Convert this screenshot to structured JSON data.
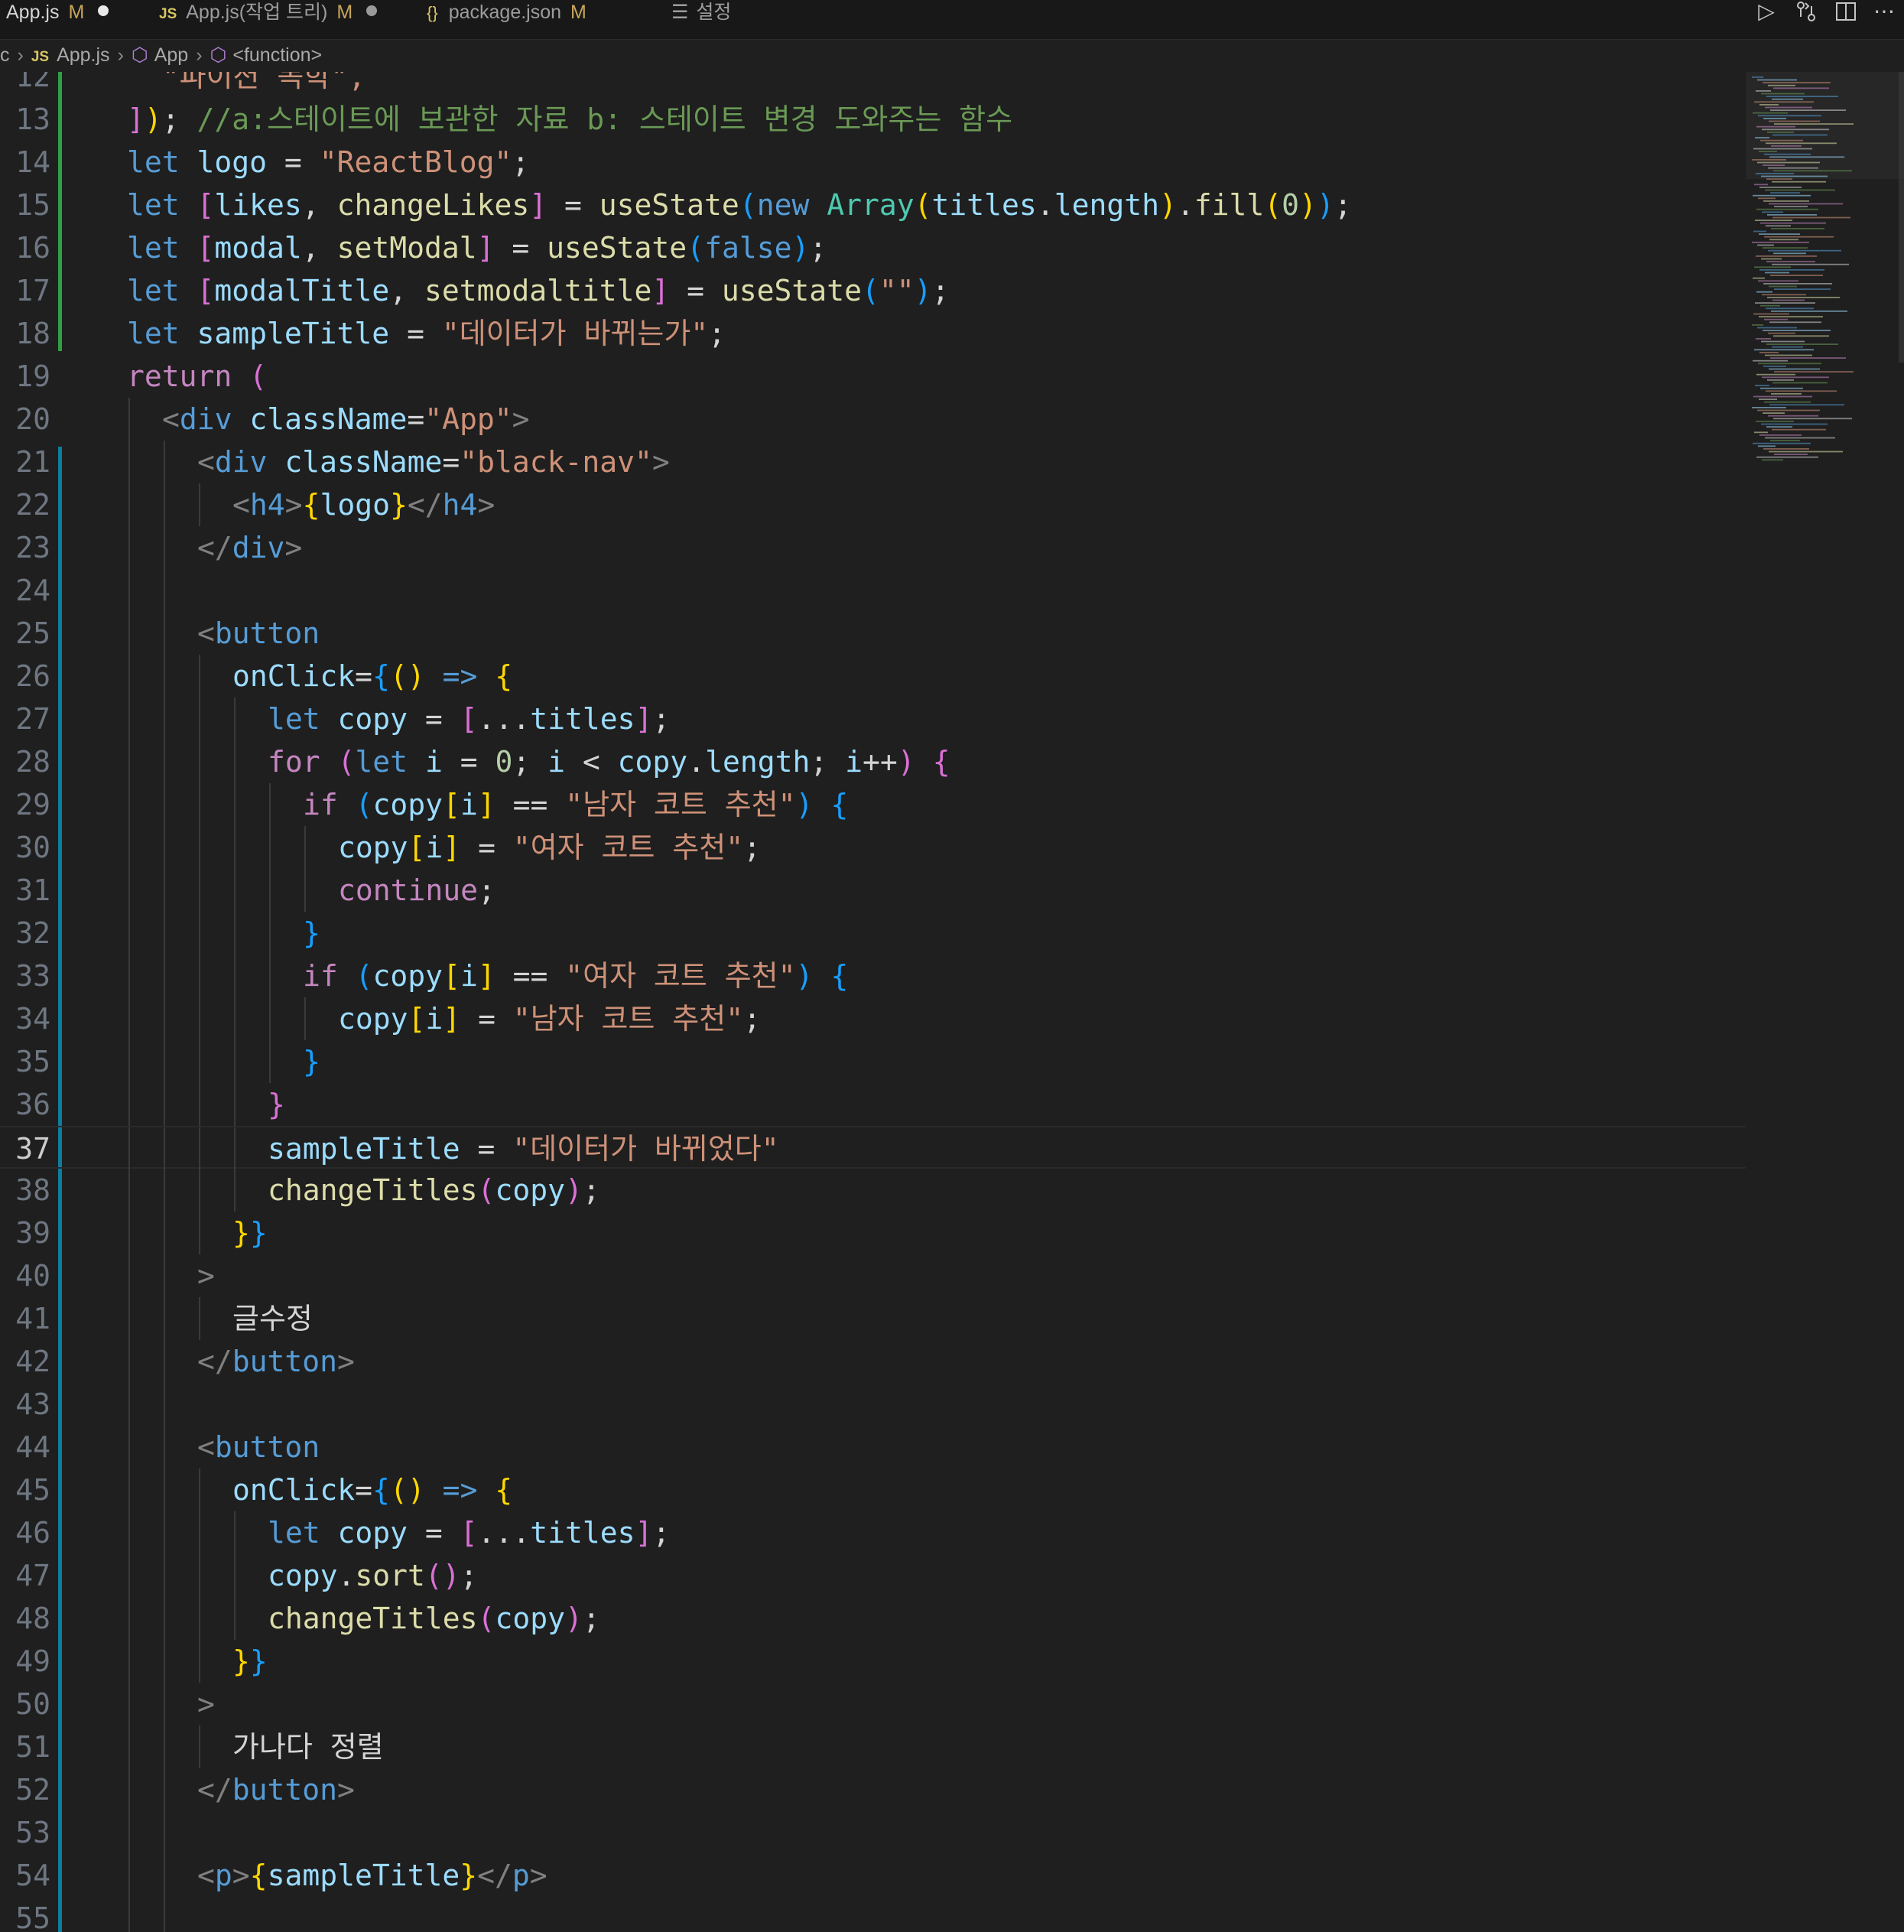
{
  "tabs": [
    {
      "label": "App.js",
      "modified": "M",
      "has_dot": true
    },
    {
      "label": "App.js(작업 트리)",
      "modified": "M",
      "has_dot": true
    },
    {
      "label": "package.json",
      "modified": "M",
      "has_dot": false
    },
    {
      "label": "설정",
      "modified": "",
      "has_dot": false
    }
  ],
  "tab_icons": {
    "js": "JS",
    "json": "{}",
    "settings": "settings-lines-icon"
  },
  "toolbar": [
    "run-icon",
    "git-compare-icon",
    "split-editor-icon",
    "more-actions-icon"
  ],
  "breadcrumbs": [
    "c",
    "App.js",
    "App",
    "<function>"
  ],
  "current_line": 37,
  "colors": {
    "keyword": "#569cd6",
    "control": "#c586c0",
    "string": "#ce9178",
    "variable": "#9cdcfe",
    "function": "#dcdcaa",
    "type": "#4ec9b0",
    "comment": "#6a9955",
    "number": "#b5cea8",
    "tag": "#569cd6",
    "tag_bracket": "#808080",
    "bracket1": "#ffd700",
    "bracket2": "#da70d6",
    "bracket3": "#179fff",
    "text": "#d4d4d4",
    "jsx_text": "#d4d4d4"
  },
  "lines": [
    {
      "n": 12,
      "indent": 1,
      "tokens": [
        [
          "s",
          "  \"파이션 독학\","
        ]
      ]
    },
    {
      "n": 13,
      "indent": 1,
      "tokens": [
        [
          "b2",
          "]"
        ],
        [
          "b1",
          ")"
        ],
        [
          "p",
          ";"
        ],
        [
          "c",
          " //a:스테이트에 보관한 자료 b: 스테이트 변경 도와주는 함수"
        ]
      ]
    },
    {
      "n": 14,
      "indent": 1,
      "tokens": [
        [
          "k",
          "let"
        ],
        [
          "p",
          " "
        ],
        [
          "v",
          "logo"
        ],
        [
          "p",
          " = "
        ],
        [
          "s",
          "\"ReactBlog\""
        ],
        [
          "p",
          ";"
        ]
      ]
    },
    {
      "n": 15,
      "indent": 1,
      "tokens": [
        [
          "k",
          "let"
        ],
        [
          "p",
          " "
        ],
        [
          "b2",
          "["
        ],
        [
          "v",
          "likes"
        ],
        [
          "p",
          ", "
        ],
        [
          "f",
          "changeLikes"
        ],
        [
          "b2",
          "]"
        ],
        [
          "p",
          " = "
        ],
        [
          "f",
          "useState"
        ],
        [
          "b3",
          "("
        ],
        [
          "k",
          "new"
        ],
        [
          "p",
          " "
        ],
        [
          "t",
          "Array"
        ],
        [
          "b1",
          "("
        ],
        [
          "v",
          "titles"
        ],
        [
          "p",
          "."
        ],
        [
          "v",
          "length"
        ],
        [
          "b1",
          ")"
        ],
        [
          "p",
          "."
        ],
        [
          "f",
          "fill"
        ],
        [
          "b1",
          "("
        ],
        [
          "n",
          "0"
        ],
        [
          "b1",
          ")"
        ],
        [
          "b3",
          ")"
        ],
        [
          "p",
          ";"
        ]
      ]
    },
    {
      "n": 16,
      "indent": 1,
      "tokens": [
        [
          "k",
          "let"
        ],
        [
          "p",
          " "
        ],
        [
          "b2",
          "["
        ],
        [
          "v",
          "modal"
        ],
        [
          "p",
          ", "
        ],
        [
          "f",
          "setModal"
        ],
        [
          "b2",
          "]"
        ],
        [
          "p",
          " = "
        ],
        [
          "f",
          "useState"
        ],
        [
          "b3",
          "("
        ],
        [
          "k",
          "false"
        ],
        [
          "b3",
          ")"
        ],
        [
          "p",
          ";"
        ]
      ]
    },
    {
      "n": 17,
      "indent": 1,
      "tokens": [
        [
          "k",
          "let"
        ],
        [
          "p",
          " "
        ],
        [
          "b2",
          "["
        ],
        [
          "v",
          "modalTitle"
        ],
        [
          "p",
          ", "
        ],
        [
          "f",
          "setmodaltitle"
        ],
        [
          "b2",
          "]"
        ],
        [
          "p",
          " = "
        ],
        [
          "f",
          "useState"
        ],
        [
          "b3",
          "("
        ],
        [
          "s",
          "\"\""
        ],
        [
          "b3",
          ")"
        ],
        [
          "p",
          ";"
        ]
      ]
    },
    {
      "n": 18,
      "indent": 1,
      "tokens": [
        [
          "k",
          "let"
        ],
        [
          "p",
          " "
        ],
        [
          "v",
          "sampleTitle"
        ],
        [
          "p",
          " = "
        ],
        [
          "s",
          "\"데이터가 바뀌는가\""
        ],
        [
          "p",
          ";"
        ]
      ]
    },
    {
      "n": 19,
      "indent": 1,
      "tokens": [
        [
          "x",
          "return"
        ],
        [
          "p",
          " "
        ],
        [
          "b2",
          "("
        ]
      ]
    },
    {
      "n": 20,
      "indent": 2,
      "tokens": [
        [
          "g",
          "<"
        ],
        [
          "tg",
          "div"
        ],
        [
          "p",
          " "
        ],
        [
          "v",
          "className"
        ],
        [
          "p",
          "="
        ],
        [
          "s",
          "\"App\""
        ],
        [
          "g",
          ">"
        ]
      ]
    },
    {
      "n": 21,
      "indent": 3,
      "tokens": [
        [
          "g",
          "<"
        ],
        [
          "tg",
          "div"
        ],
        [
          "p",
          " "
        ],
        [
          "v",
          "className"
        ],
        [
          "p",
          "="
        ],
        [
          "s",
          "\"black-nav\""
        ],
        [
          "g",
          ">"
        ]
      ]
    },
    {
      "n": 22,
      "indent": 4,
      "tokens": [
        [
          "g",
          "<"
        ],
        [
          "tg",
          "h4"
        ],
        [
          "g",
          ">"
        ],
        [
          "b1",
          "{"
        ],
        [
          "v",
          "logo"
        ],
        [
          "b1",
          "}"
        ],
        [
          "g",
          "</"
        ],
        [
          "tg",
          "h4"
        ],
        [
          "g",
          ">"
        ]
      ]
    },
    {
      "n": 23,
      "indent": 3,
      "tokens": [
        [
          "g",
          "</"
        ],
        [
          "tg",
          "div"
        ],
        [
          "g",
          ">"
        ]
      ]
    },
    {
      "n": 24,
      "indent": 3,
      "tokens": []
    },
    {
      "n": 25,
      "indent": 3,
      "tokens": [
        [
          "g",
          "<"
        ],
        [
          "tg",
          "button"
        ]
      ]
    },
    {
      "n": 26,
      "indent": 4,
      "tokens": [
        [
          "v",
          "onClick"
        ],
        [
          "p",
          "="
        ],
        [
          "b3",
          "{"
        ],
        [
          "b1",
          "()"
        ],
        [
          "p",
          " "
        ],
        [
          "k",
          "=>"
        ],
        [
          "p",
          " "
        ],
        [
          "b1",
          "{"
        ]
      ]
    },
    {
      "n": 27,
      "indent": 5,
      "tokens": [
        [
          "k",
          "let"
        ],
        [
          "p",
          " "
        ],
        [
          "v",
          "copy"
        ],
        [
          "p",
          " = "
        ],
        [
          "b2",
          "["
        ],
        [
          "p",
          "..."
        ],
        [
          "v",
          "titles"
        ],
        [
          "b2",
          "]"
        ],
        [
          "p",
          ";"
        ]
      ]
    },
    {
      "n": 28,
      "indent": 5,
      "tokens": [
        [
          "x",
          "for"
        ],
        [
          "p",
          " "
        ],
        [
          "b2",
          "("
        ],
        [
          "k",
          "let"
        ],
        [
          "p",
          " "
        ],
        [
          "v",
          "i"
        ],
        [
          "p",
          " = "
        ],
        [
          "n",
          "0"
        ],
        [
          "p",
          "; "
        ],
        [
          "v",
          "i"
        ],
        [
          "p",
          " < "
        ],
        [
          "v",
          "copy"
        ],
        [
          "p",
          "."
        ],
        [
          "v",
          "length"
        ],
        [
          "p",
          "; "
        ],
        [
          "v",
          "i"
        ],
        [
          "p",
          "++"
        ],
        [
          "b2",
          ")"
        ],
        [
          "p",
          " "
        ],
        [
          "b2",
          "{"
        ]
      ]
    },
    {
      "n": 29,
      "indent": 6,
      "tokens": [
        [
          "x",
          "if"
        ],
        [
          "p",
          " "
        ],
        [
          "b3",
          "("
        ],
        [
          "v",
          "copy"
        ],
        [
          "b1",
          "["
        ],
        [
          "v",
          "i"
        ],
        [
          "b1",
          "]"
        ],
        [
          "p",
          " == "
        ],
        [
          "s",
          "\"남자 코트 추천\""
        ],
        [
          "b3",
          ")"
        ],
        [
          "p",
          " "
        ],
        [
          "b3",
          "{"
        ]
      ]
    },
    {
      "n": 30,
      "indent": 7,
      "tokens": [
        [
          "v",
          "copy"
        ],
        [
          "b1",
          "["
        ],
        [
          "v",
          "i"
        ],
        [
          "b1",
          "]"
        ],
        [
          "p",
          " = "
        ],
        [
          "s",
          "\"여자 코트 추천\""
        ],
        [
          "p",
          ";"
        ]
      ]
    },
    {
      "n": 31,
      "indent": 7,
      "tokens": [
        [
          "x",
          "continue"
        ],
        [
          "p",
          ";"
        ]
      ]
    },
    {
      "n": 32,
      "indent": 6,
      "tokens": [
        [
          "b3",
          "}"
        ]
      ]
    },
    {
      "n": 33,
      "indent": 6,
      "tokens": [
        [
          "x",
          "if"
        ],
        [
          "p",
          " "
        ],
        [
          "b3",
          "("
        ],
        [
          "v",
          "copy"
        ],
        [
          "b1",
          "["
        ],
        [
          "v",
          "i"
        ],
        [
          "b1",
          "]"
        ],
        [
          "p",
          " == "
        ],
        [
          "s",
          "\"여자 코트 추천\""
        ],
        [
          "b3",
          ")"
        ],
        [
          "p",
          " "
        ],
        [
          "b3",
          "{"
        ]
      ]
    },
    {
      "n": 34,
      "indent": 7,
      "tokens": [
        [
          "v",
          "copy"
        ],
        [
          "b1",
          "["
        ],
        [
          "v",
          "i"
        ],
        [
          "b1",
          "]"
        ],
        [
          "p",
          " = "
        ],
        [
          "s",
          "\"남자 코트 추천\""
        ],
        [
          "p",
          ";"
        ]
      ]
    },
    {
      "n": 35,
      "indent": 6,
      "tokens": [
        [
          "b3",
          "}"
        ]
      ]
    },
    {
      "n": 36,
      "indent": 5,
      "tokens": [
        [
          "b2",
          "}"
        ]
      ]
    },
    {
      "n": 37,
      "indent": 5,
      "tokens": [
        [
          "v",
          "sampleTitle"
        ],
        [
          "p",
          " = "
        ],
        [
          "s",
          "\"데이터가 바뀌었다\""
        ]
      ]
    },
    {
      "n": 38,
      "indent": 5,
      "tokens": [
        [
          "f",
          "changeTitles"
        ],
        [
          "b2",
          "("
        ],
        [
          "v",
          "copy"
        ],
        [
          "b2",
          ")"
        ],
        [
          "p",
          ";"
        ]
      ]
    },
    {
      "n": 39,
      "indent": 4,
      "tokens": [
        [
          "b1",
          "}"
        ],
        [
          "b3",
          "}"
        ]
      ]
    },
    {
      "n": 40,
      "indent": 3,
      "tokens": [
        [
          "g",
          ">"
        ]
      ]
    },
    {
      "n": 41,
      "indent": 4,
      "tokens": [
        [
          "j",
          "글수정"
        ]
      ]
    },
    {
      "n": 42,
      "indent": 3,
      "tokens": [
        [
          "g",
          "</"
        ],
        [
          "tg",
          "button"
        ],
        [
          "g",
          ">"
        ]
      ]
    },
    {
      "n": 43,
      "indent": 3,
      "tokens": []
    },
    {
      "n": 44,
      "indent": 3,
      "tokens": [
        [
          "g",
          "<"
        ],
        [
          "tg",
          "button"
        ]
      ]
    },
    {
      "n": 45,
      "indent": 4,
      "tokens": [
        [
          "v",
          "onClick"
        ],
        [
          "p",
          "="
        ],
        [
          "b3",
          "{"
        ],
        [
          "b1",
          "()"
        ],
        [
          "p",
          " "
        ],
        [
          "k",
          "=>"
        ],
        [
          "p",
          " "
        ],
        [
          "b1",
          "{"
        ]
      ]
    },
    {
      "n": 46,
      "indent": 5,
      "tokens": [
        [
          "k",
          "let"
        ],
        [
          "p",
          " "
        ],
        [
          "v",
          "copy"
        ],
        [
          "p",
          " = "
        ],
        [
          "b2",
          "["
        ],
        [
          "p",
          "..."
        ],
        [
          "v",
          "titles"
        ],
        [
          "b2",
          "]"
        ],
        [
          "p",
          ";"
        ]
      ]
    },
    {
      "n": 47,
      "indent": 5,
      "tokens": [
        [
          "v",
          "copy"
        ],
        [
          "p",
          "."
        ],
        [
          "f",
          "sort"
        ],
        [
          "b2",
          "()"
        ],
        [
          "p",
          ";"
        ]
      ]
    },
    {
      "n": 48,
      "indent": 5,
      "tokens": [
        [
          "f",
          "changeTitles"
        ],
        [
          "b2",
          "("
        ],
        [
          "v",
          "copy"
        ],
        [
          "b2",
          ")"
        ],
        [
          "p",
          ";"
        ]
      ]
    },
    {
      "n": 49,
      "indent": 4,
      "tokens": [
        [
          "b1",
          "}"
        ],
        [
          "b3",
          "}"
        ]
      ]
    },
    {
      "n": 50,
      "indent": 3,
      "tokens": [
        [
          "g",
          ">"
        ]
      ]
    },
    {
      "n": 51,
      "indent": 4,
      "tokens": [
        [
          "j",
          "가나다 정렬"
        ]
      ]
    },
    {
      "n": 52,
      "indent": 3,
      "tokens": [
        [
          "g",
          "</"
        ],
        [
          "tg",
          "button"
        ],
        [
          "g",
          ">"
        ]
      ]
    },
    {
      "n": 53,
      "indent": 3,
      "tokens": []
    },
    {
      "n": 54,
      "indent": 3,
      "tokens": [
        [
          "g",
          "<"
        ],
        [
          "tg",
          "p"
        ],
        [
          "g",
          ">"
        ],
        [
          "b1",
          "{"
        ],
        [
          "v",
          "sampleTitle"
        ],
        [
          "b1",
          "}"
        ],
        [
          "g",
          "</"
        ],
        [
          "tg",
          "p"
        ],
        [
          "g",
          ">"
        ]
      ]
    },
    {
      "n": 55,
      "indent": 3,
      "tokens": []
    }
  ]
}
